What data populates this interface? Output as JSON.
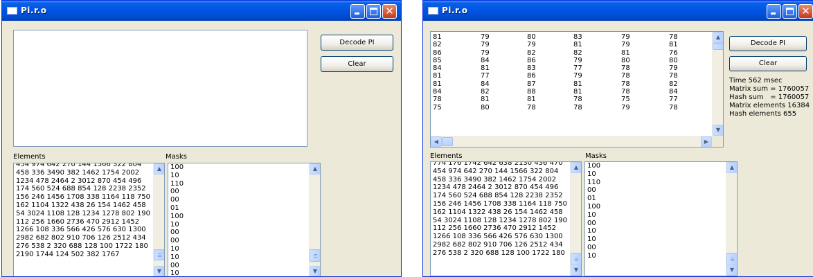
{
  "window1": {
    "title": "Pi.r.o",
    "decode_label": "Decode PI",
    "clear_label": "Clear",
    "elements_label": "Elements",
    "masks_label": "Masks",
    "elements": [
      "454 974 642 270 144 1566 322 804",
      "458 336 3490 382 1462 1754 2002",
      "1234 478 2464 2 3012 870 454 496",
      "174 560 524 688 854 128 2238 2352",
      "156 246 1456 1708 338 1164 118 750",
      "162 1104 1322 438 26 154 1462 458",
      "54 3024 1108 128 1234 1278 802 190",
      "112 256 1660 2736 470 2912 1452",
      "1266 108 336 566 426 576 630 1300",
      "2982 682 802 910 706 126 2512 434",
      "276 538 2 320 688 128 100 1722 180",
      "2190 1744 124 502 382 1767"
    ],
    "masks": [
      "100",
      "10",
      "110",
      "00",
      "00",
      "01",
      "100",
      "10",
      "00",
      "00",
      "10",
      "10",
      "00",
      "10"
    ]
  },
  "window2": {
    "title": "Pi.r.o",
    "decode_label": "Decode PI",
    "clear_label": "Clear",
    "elements_label": "Elements",
    "masks_label": "Masks",
    "matrix": [
      [
        "81",
        "79",
        "80",
        "83",
        "79",
        "78"
      ],
      [
        "82",
        "79",
        "79",
        "81",
        "79",
        "81"
      ],
      [
        "86",
        "79",
        "82",
        "82",
        "81",
        "76"
      ],
      [
        "85",
        "84",
        "86",
        "79",
        "80",
        "80"
      ],
      [
        "84",
        "81",
        "83",
        "77",
        "78",
        "79"
      ],
      [
        "81",
        "77",
        "86",
        "79",
        "78",
        "78"
      ],
      [
        "81",
        "84",
        "87",
        "81",
        "78",
        "82"
      ],
      [
        "84",
        "82",
        "88",
        "81",
        "78",
        "84"
      ],
      [
        "78",
        "81",
        "81",
        "78",
        "75",
        "77"
      ],
      [
        "75",
        "80",
        "78",
        "78",
        "79",
        "78"
      ]
    ],
    "info": {
      "time": "Time 562 msec",
      "matrix_sum": "Matrix sum = 1760057",
      "hash_sum": "Hash sum   = 1760057",
      "matrix_elements": "Matrix elements 16384",
      "hash_elements": "Hash elements 655"
    },
    "elements": [
      "774 176 1742 642 638 2130 436 470",
      "454 974 642 270 144 1566 322 804",
      "458 336 3490 382 1462 1754 2002",
      "1234 478 2464 2 3012 870 454 496",
      "174 560 524 688 854 128 2238 2352",
      "156 246 1456 1708 338 1164 118 750",
      "162 1104 1322 438 26 154 1462 458",
      "54 3024 1108 128 1234 1278 802 190",
      "112 256 1660 2736 470 2912 1452",
      "1266 108 336 566 426 576 630 1300",
      "2982 682 802 910 706 126 2512 434",
      "276 538 2 320 688 128 100 1722 180"
    ],
    "masks": [
      "100",
      "10",
      "110",
      "00",
      "01",
      "100",
      "10",
      "00",
      "10",
      "10",
      "00",
      "10"
    ]
  }
}
